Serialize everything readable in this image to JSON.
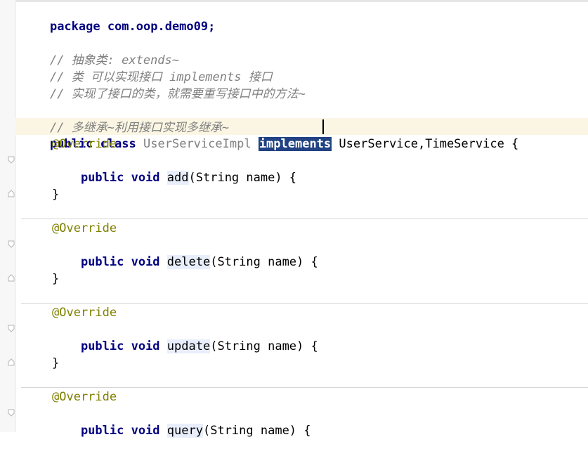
{
  "editor": {
    "package_line": "package com.oop.demo09;",
    "comments": [
      "// 抽象类: extends~",
      "// 类 可以实现接口 implements 接口",
      "// 实现了接口的类，就需要重写接口中的方法~",
      "// 多继承~利用接口实现多继承~"
    ],
    "class_decl": {
      "modifiers": "public class",
      "class_name": "UserServiceImpl",
      "selected_keyword": "implements",
      "interfaces": "UserService,TimeService {"
    },
    "methods": [
      {
        "annotation": "@Override",
        "prefix": "public void",
        "name": "add",
        "params": "(String name) {",
        "close": "}"
      },
      {
        "annotation": "@Override",
        "prefix": "public void",
        "name": "delete",
        "params": "(String name) {",
        "close": "}"
      },
      {
        "annotation": "@Override",
        "prefix": "public void",
        "name": "update",
        "params": "(String name) {",
        "close": "}"
      },
      {
        "annotation": "@Override",
        "prefix": "public void",
        "name": "query",
        "params": "(String name) {"
      }
    ]
  },
  "colors": {
    "keyword": "#000080",
    "comment": "#808080",
    "annotation": "#808000",
    "selection": "#214283",
    "caret_line": "#fbf6e3"
  }
}
